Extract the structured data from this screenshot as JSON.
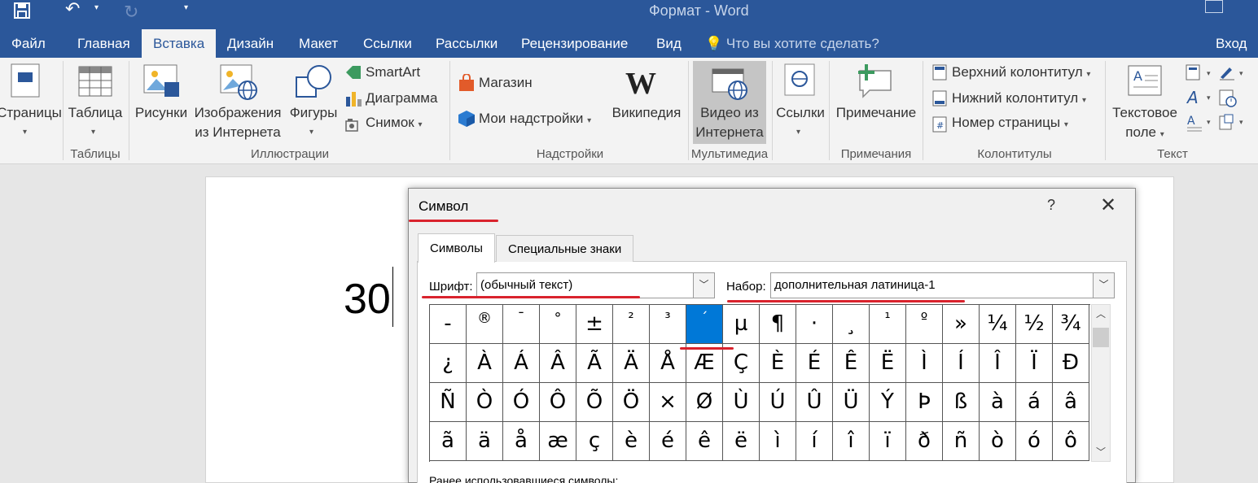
{
  "window": {
    "title": "Формат - Word"
  },
  "quick_access": {
    "save_icon": "save-icon",
    "undo_icon": "undo-icon",
    "redo_icon": "redo-icon"
  },
  "tabs": [
    {
      "label": "Файл"
    },
    {
      "label": "Главная"
    },
    {
      "label": "Вставка",
      "active": true
    },
    {
      "label": "Дизайн"
    },
    {
      "label": "Макет"
    },
    {
      "label": "Ссылки"
    },
    {
      "label": "Рассылки"
    },
    {
      "label": "Рецензирование"
    },
    {
      "label": "Вид"
    }
  ],
  "tell_me": "Что вы хотите сделать?",
  "sign_in": "Вход",
  "ribbon": {
    "pages": "Страницы",
    "table": "Таблица",
    "tables_group": "Таблицы",
    "pictures": "Рисунки",
    "online_pictures_1": "Изображения",
    "online_pictures_2": "из Интернета",
    "shapes": "Фигуры",
    "smartart": "SmartArt",
    "chart": "Диаграмма",
    "screenshot": "Снимок",
    "illustrations_group": "Иллюстрации",
    "store": "Магазин",
    "my_addins": "Мои надстройки",
    "wikipedia": "Википедия",
    "addins_group": "Надстройки",
    "online_video_1": "Видео из",
    "online_video_2": "Интернета",
    "media_group": "Мультимедиа",
    "links": "Ссылки",
    "comment": "Примечание",
    "comments_group": "Примечания",
    "header": "Верхний колонтитул",
    "footer": "Нижний колонтитул",
    "page_number": "Номер страницы",
    "header_footer_group": "Колонтитулы",
    "textbox_1": "Текстовое",
    "textbox_2": "поле",
    "text_group": "Текст"
  },
  "document": {
    "text": "30"
  },
  "dialog": {
    "title": "Символ",
    "help": "?",
    "close": "✕",
    "tabs": [
      "Символы",
      "Специальные знаки"
    ],
    "font_label": "Шрифт:",
    "font_value": "(обычный текст)",
    "subset_label": "Набор:",
    "subset_value": "дополнительная латиница-1",
    "recent_label": "Ранее использовавшиеся символы:",
    "symbols": [
      [
        "-",
        "®",
        "¯",
        "°",
        "±",
        "²",
        "³",
        "´",
        "µ",
        "¶",
        "·",
        "¸",
        "¹",
        "º",
        "»",
        "¼",
        "½",
        "¾"
      ],
      [
        "¿",
        "À",
        "Á",
        "Â",
        "Ã",
        "Ä",
        "Å",
        "Æ",
        "Ç",
        "È",
        "É",
        "Ê",
        "Ë",
        "Ì",
        "Í",
        "Î",
        "Ï",
        "Ð"
      ],
      [
        "Ñ",
        "Ò",
        "Ó",
        "Ô",
        "Õ",
        "Ö",
        "×",
        "Ø",
        "Ù",
        "Ú",
        "Û",
        "Ü",
        "Ý",
        "Þ",
        "ß",
        "à",
        "á",
        "â"
      ],
      [
        "ã",
        "ä",
        "å",
        "æ",
        "ç",
        "è",
        "é",
        "ê",
        "ë",
        "ì",
        "í",
        "î",
        "ï",
        "ð",
        "ñ",
        "ò",
        "ó",
        "ô"
      ]
    ],
    "selected": {
      "row": 0,
      "col": 7
    }
  },
  "colors": {
    "accent": "#2b579a",
    "selection": "#0078d7",
    "annotation": "#d9232d"
  }
}
